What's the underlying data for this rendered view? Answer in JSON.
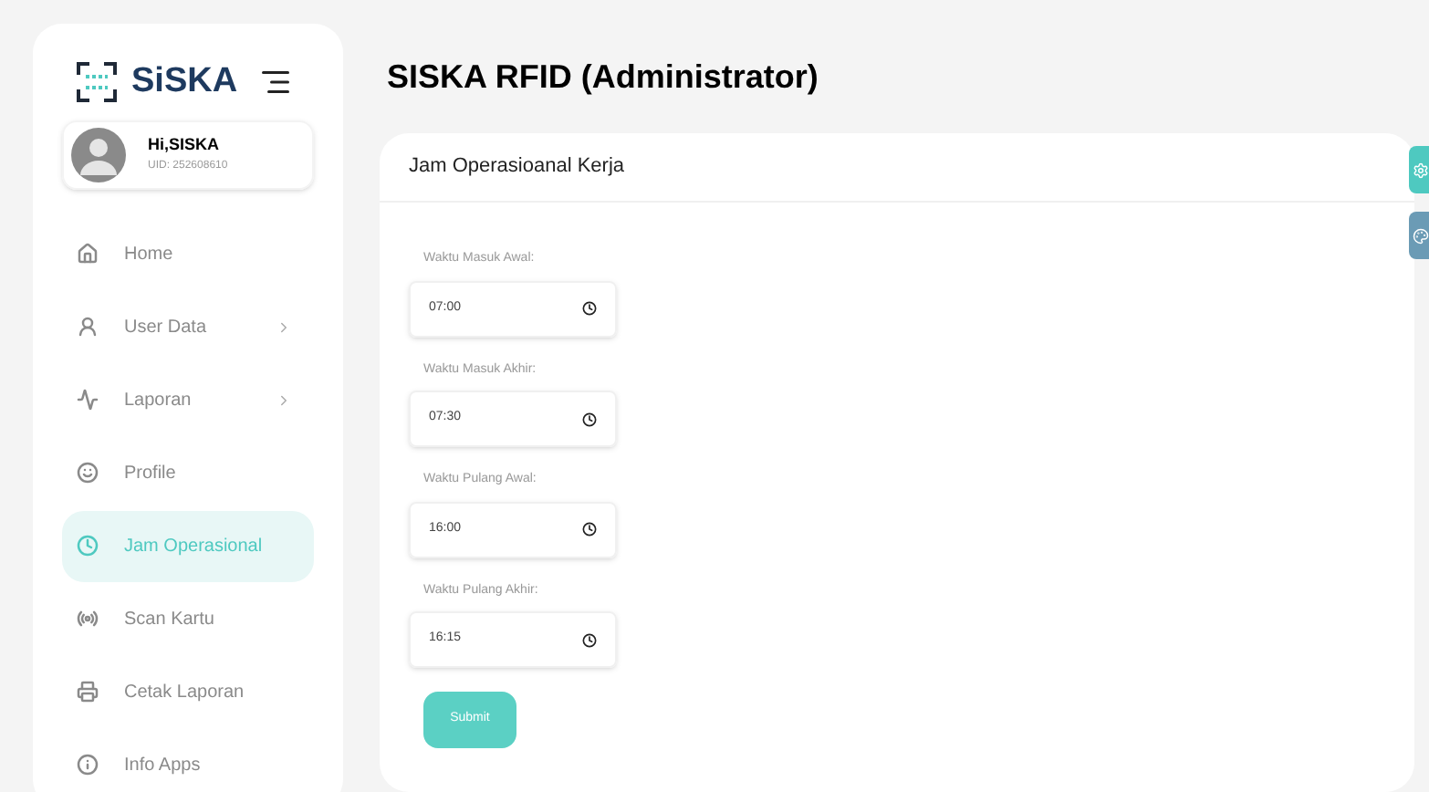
{
  "brand": "SiSKA",
  "user": {
    "greeting": "Hi,SISKA",
    "uid": "UID: 252608610"
  },
  "sidebar": {
    "items": [
      {
        "kind": "home",
        "label": "Home",
        "selected": false,
        "has_submenu": false
      },
      {
        "kind": "user",
        "label": "User Data",
        "selected": false,
        "has_submenu": true
      },
      {
        "kind": "report",
        "label": "Laporan",
        "selected": false,
        "has_submenu": true
      },
      {
        "kind": "profile",
        "label": "Profile",
        "selected": false,
        "has_submenu": false
      },
      {
        "kind": "clock",
        "label": "Jam Operasional",
        "selected": true,
        "has_submenu": false
      },
      {
        "kind": "scan",
        "label": "Scan Kartu",
        "selected": false,
        "has_submenu": false
      },
      {
        "kind": "print",
        "label": "Cetak Laporan",
        "selected": false,
        "has_submenu": false
      },
      {
        "kind": "info",
        "label": "Info Apps",
        "selected": false,
        "has_submenu": false
      }
    ]
  },
  "page_title": "SISKA RFID (Administrator)",
  "card": {
    "title": "Jam Operasioanal Kerja",
    "fields": [
      {
        "label": "Waktu Masuk Awal:",
        "value": "07:00"
      },
      {
        "label": "Waktu Masuk Akhir:",
        "value": "07:30"
      },
      {
        "label": "Waktu Pulang Awal:",
        "value": "16:00"
      },
      {
        "label": "Waktu Pulang Akhir:",
        "value": "16:15"
      }
    ],
    "submit": "Submit"
  }
}
